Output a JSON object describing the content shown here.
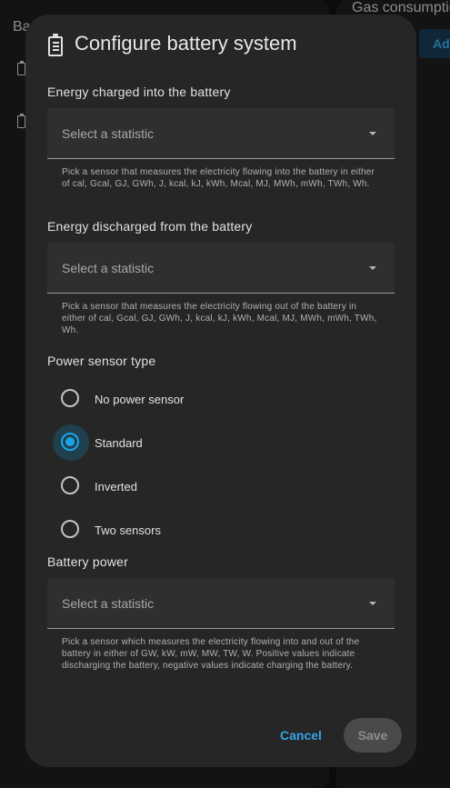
{
  "background": {
    "left_card_title": "Ba",
    "right_card_title": "Gas consumptio",
    "right_card_button": "Ade"
  },
  "dialog": {
    "title": "Configure battery system",
    "icon": "battery-icon",
    "energy_charged": {
      "label": "Energy charged into the battery",
      "placeholder": "Select a statistic",
      "helper": "Pick a sensor that measures the electricity flowing into the battery in either of cal, Gcal, GJ, GWh, J, kcal, kJ, kWh, Mcal, MJ, MWh, mWh, TWh, Wh."
    },
    "energy_discharged": {
      "label": "Energy discharged from the battery",
      "placeholder": "Select a statistic",
      "helper": "Pick a sensor that measures the electricity flowing out of the battery in either of cal, Gcal, GJ, GWh, J, kcal, kJ, kWh, Mcal, MJ, MWh, mWh, TWh, Wh."
    },
    "power_sensor_type": {
      "label": "Power sensor type",
      "options": [
        {
          "label": "No power sensor",
          "checked": false
        },
        {
          "label": "Standard",
          "checked": true
        },
        {
          "label": "Inverted",
          "checked": false
        },
        {
          "label": "Two sensors",
          "checked": false
        }
      ]
    },
    "battery_power": {
      "label": "Battery power",
      "placeholder": "Select a statistic",
      "helper": "Pick a sensor which measures the electricity flowing into and out of the battery in either of GW, kW, mW, MW, TW, W. Positive values indicate discharging the battery, negative values indicate charging the battery."
    },
    "actions": {
      "cancel": "Cancel",
      "save": "Save"
    }
  },
  "colors": {
    "accent": "#03a9f4",
    "dialog_bg": "#262626",
    "field_bg": "#2f2f2f"
  }
}
